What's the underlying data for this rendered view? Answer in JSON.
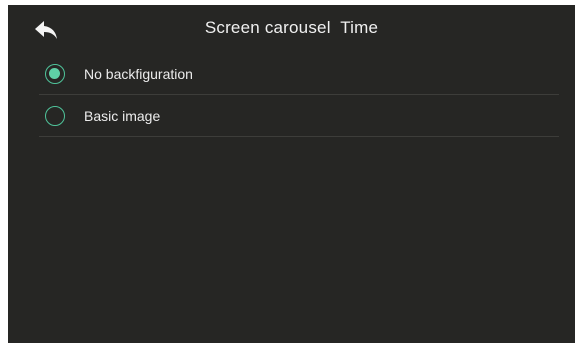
{
  "header": {
    "title": "Screen carousel  Time",
    "back_icon": "back-arrow-icon"
  },
  "options": [
    {
      "label": "No backfiguration",
      "selected": true
    },
    {
      "label": "Basic image",
      "selected": false
    }
  ],
  "colors": {
    "background": "#262624",
    "accent": "#5fd0a6",
    "divider": "#3d3d3a"
  }
}
